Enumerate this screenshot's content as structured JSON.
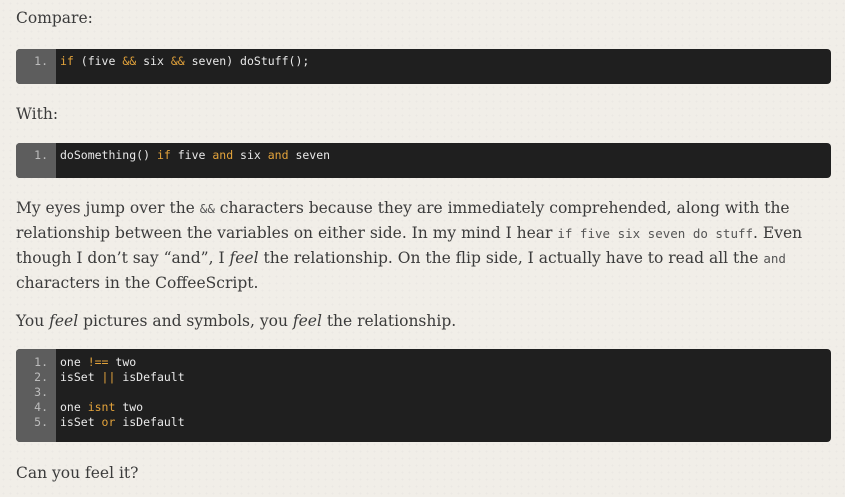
{
  "p_compare": "Compare:",
  "block1": {
    "lines": [
      [
        {
          "t": "if",
          "k": true
        },
        {
          "t": " (five ",
          "k": false
        },
        {
          "t": "&&",
          "k": true
        },
        {
          "t": " six ",
          "k": false
        },
        {
          "t": "&&",
          "k": true
        },
        {
          "t": " seven) doStuff();",
          "k": false
        }
      ]
    ]
  },
  "p_with": "With:",
  "block2": {
    "lines": [
      [
        {
          "t": "doSomething() ",
          "k": false
        },
        {
          "t": "if",
          "k": true
        },
        {
          "t": " five ",
          "k": false
        },
        {
          "t": "and",
          "k": true
        },
        {
          "t": " six ",
          "k": false
        },
        {
          "t": "and",
          "k": true
        },
        {
          "t": " seven",
          "k": false
        }
      ]
    ]
  },
  "para": {
    "s1": "My eyes jump over the ",
    "c1": "&&",
    "s2": " characters because they are immediately comprehended, along with the relationship between the variables on either side. In my mind I hear ",
    "c2": "if five six seven do stuff",
    "s3": ". Even though I don’t say “and”, I ",
    "e1": "feel",
    "s4": " the relationship. On the flip side, I actually have to read all the ",
    "c3": "and",
    "s5": " characters in the CoffeeScript."
  },
  "p_feel": {
    "s1": "You ",
    "e1": "feel",
    "s2": " pictures and symbols, you ",
    "e2": "feel",
    "s3": " the relationship."
  },
  "block3": {
    "lines": [
      [
        {
          "t": "one ",
          "k": false
        },
        {
          "t": "!==",
          "k": true
        },
        {
          "t": " two",
          "k": false
        }
      ],
      [
        {
          "t": "isSet ",
          "k": false
        },
        {
          "t": "||",
          "k": true
        },
        {
          "t": " isDefault",
          "k": false
        }
      ],
      [],
      [
        {
          "t": "one ",
          "k": false
        },
        {
          "t": "isnt",
          "k": true
        },
        {
          "t": " two",
          "k": false
        }
      ],
      [
        {
          "t": "isSet ",
          "k": false
        },
        {
          "t": "or",
          "k": true
        },
        {
          "t": " isDefault",
          "k": false
        }
      ]
    ]
  },
  "p_can": "Can you feel it?"
}
